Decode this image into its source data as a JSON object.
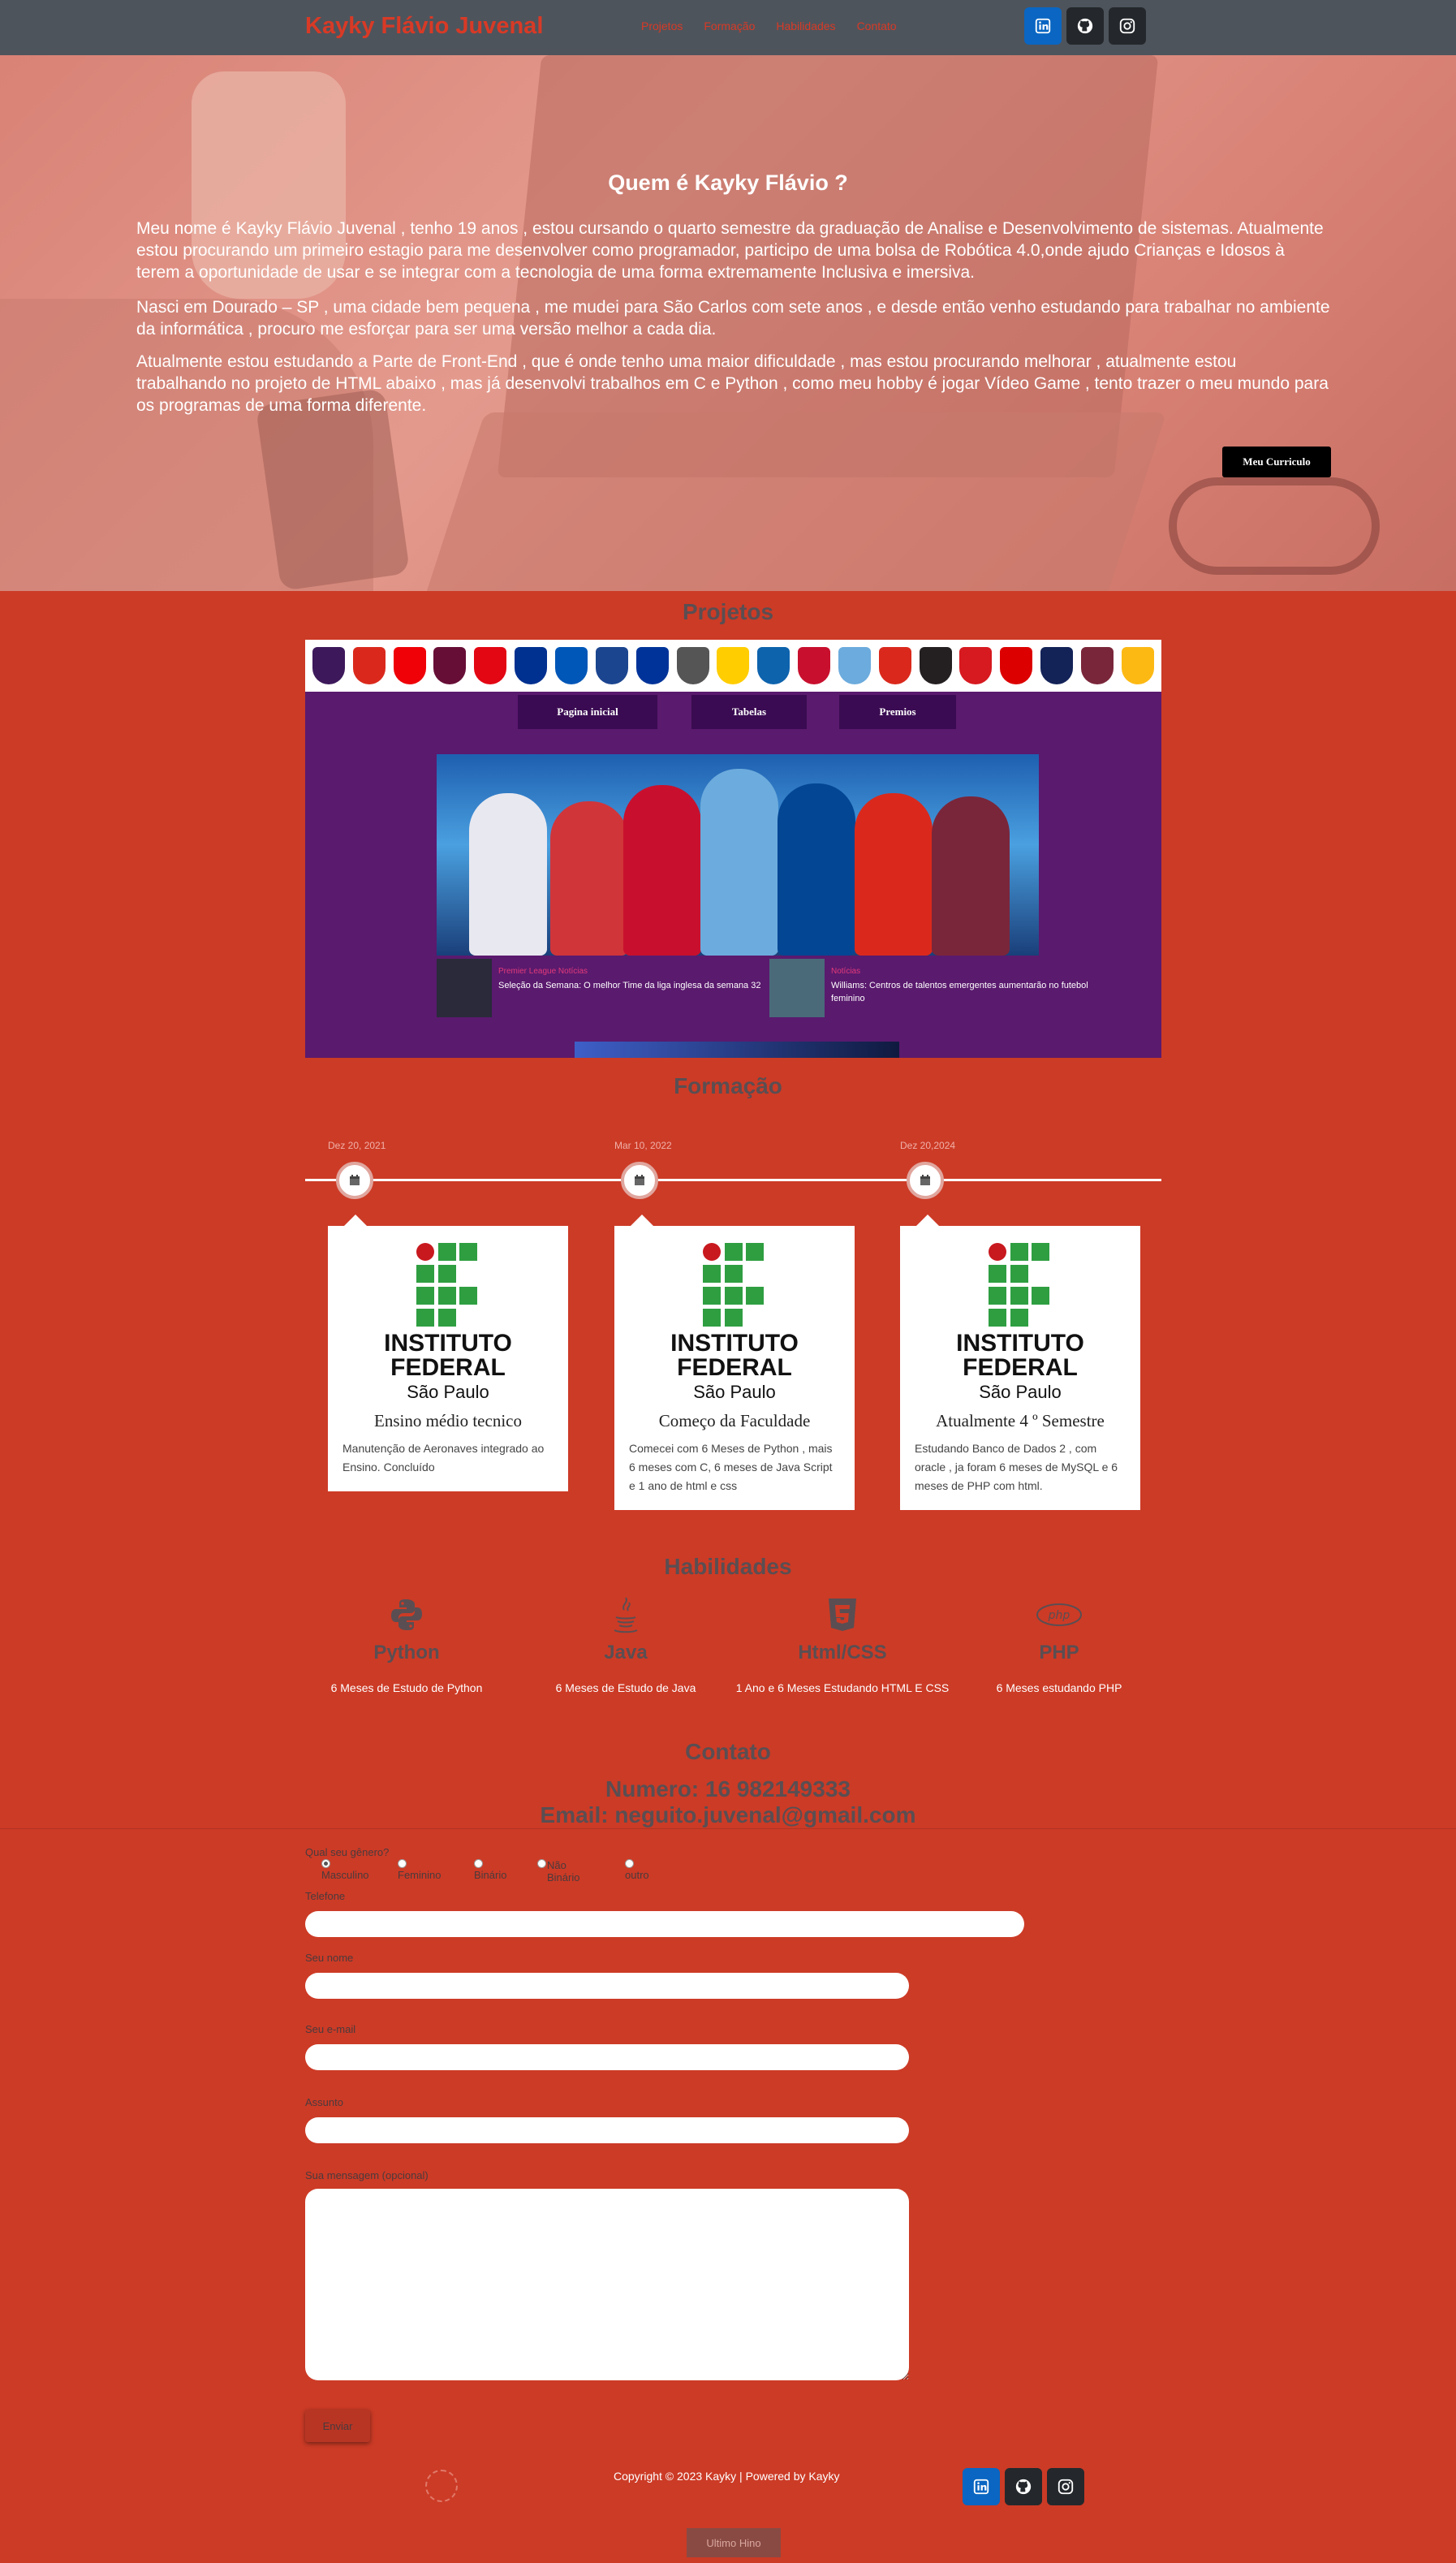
{
  "navbar": {
    "brand": "Kayky Flávio Juvenal",
    "links": [
      "Projetos",
      "Formação",
      "Habilidades",
      "Contato"
    ],
    "social_icons": [
      "linkedin-icon",
      "github-icon",
      "instagram-icon"
    ]
  },
  "hero": {
    "title": "Quem é Kayky Flávio ?",
    "paragraphs": [
      "Meu nome é Kayky Flávio Juvenal , tenho 19 anos , estou cursando o quarto semestre da graduação de Analise e Desenvolvimento de sistemas. Atualmente estou procurando um primeiro estagio para me desenvolver como programador, participo de uma bolsa de Robótica 4.0,onde ajudo Crianças e Idosos à terem a oportunidade de usar e se integrar com a tecnologia de uma forma extremamente Inclusiva e imersiva.",
      "Nasci em Dourado – SP , uma cidade bem pequena , me mudei para São Carlos com sete anos , e desde então venho estudando para trabalhar no ambiente da informática , procuro me esforçar para ser uma versão melhor a cada dia.",
      "Atualmente estou estudando a Parte de Front-End , que é onde tenho uma maior dificuldade , mas estou procurando melhorar , atualmente estou trabalhando no projeto de HTML abaixo , mas já desenvolvi trabalhos em C e Python , como meu hobby é jogar Vídeo Game , tento trazer o meu mundo para os programas de uma forma diferente."
    ],
    "cv_button": "Meu Curriculo"
  },
  "projects": {
    "title": "Projetos",
    "preview_nav": [
      "Pagina inicial",
      "Tabelas",
      "Premios"
    ],
    "news": [
      {
        "tag": "Premier League Notícias",
        "title": "Seleção da Semana: O melhor Time da liga inglesa da semana 32"
      },
      {
        "tag": "Notícias",
        "title": "Williams: Centros de talentos emergentes aumentarão no futebol feminino"
      }
    ],
    "colors": {
      "preview_bg": "#5a1a6e",
      "nav_bg": "#3a0b52"
    }
  },
  "education": {
    "title": "Formação",
    "institution_name": "INSTITUTO FEDERAL",
    "institution_campus": "São Paulo",
    "items": [
      {
        "date": "Dez 20, 2021",
        "heading": "Ensino médio tecnico",
        "text": "Manutenção de Aeronaves integrado ao Ensino. Concluído"
      },
      {
        "date": "Mar 10, 2022",
        "heading": "Começo da Faculdade",
        "text": "Comecei com 6 Meses de Python , mais 6 meses com C, 6 meses de Java Script e 1 ano de html e css"
      },
      {
        "date": "Dez 20,2024",
        "heading": "Atualmente 4 º Semestre",
        "text": "Estudando Banco de Dados 2 , com oracle , ja foram 6 meses de MySQL e 6 meses de PHP com html."
      }
    ]
  },
  "skills": {
    "title": "Habilidades",
    "items": [
      {
        "icon": "python-icon",
        "name": "Python",
        "desc": "6 Meses de Estudo de Python"
      },
      {
        "icon": "java-icon",
        "name": "Java",
        "desc": "6 Meses de Estudo de Java"
      },
      {
        "icon": "html5-icon",
        "name": "Html/CSS",
        "desc": "1 Ano e 6 Meses Estudando HTML E CSS"
      },
      {
        "icon": "php-icon",
        "name": "PHP",
        "desc": "6 Meses estudando PHP"
      }
    ]
  },
  "contact": {
    "title": "Contato",
    "phone": "Numero: 16 982149333",
    "email": "Email: neguito.juvenal@gmail.com",
    "gender_label": "Qual seu gênero?",
    "gender_options": [
      "Masculino",
      "Feminino",
      "Binário",
      "Não Binário",
      "outro"
    ],
    "gender_selected": "Masculino",
    "phone_label": "Telefone",
    "name_label": "Seu nome",
    "email_label": "Seu e-mail",
    "subject_label": "Assunto",
    "message_label": "Sua mensagem (opcional)",
    "send_button": "Enviar"
  },
  "footer": {
    "copyright": "Copyright © 2023 Kayky | Powered by Kayky",
    "social_icons": [
      "linkedin-icon",
      "github-icon",
      "instagram-icon"
    ],
    "bottom_button": "Ultimo Hino"
  },
  "colors": {
    "page_bg": "#cc3b26",
    "navbar_bg": "#4e545c",
    "brand": "#d83a26",
    "linkedin": "#0a66c2"
  }
}
